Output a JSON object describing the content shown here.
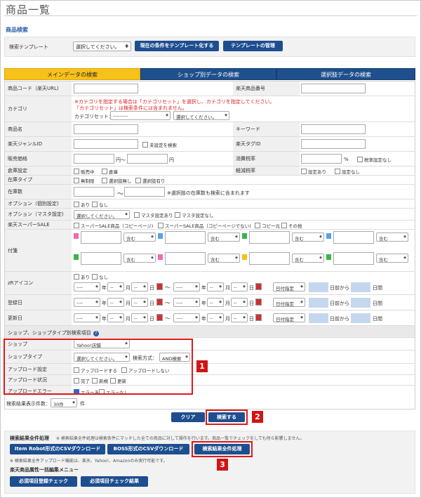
{
  "page": {
    "title": "商品一覧",
    "section": "商品検索"
  },
  "template": {
    "label": "検索テンプレート",
    "select_value": "選択してください。",
    "save_button": "現在の条件をテンプレート化する",
    "manage_button": "テンプレートの管理"
  },
  "tabs": [
    "メインデータの検索",
    "ショップ別データの検索",
    "選択肢データの検索"
  ],
  "labels": {
    "product_code": "商品コード（楽天URL)",
    "rakuten_no": "楽天商品番号",
    "category": "カテゴリ",
    "product_name": "商品名",
    "keyword": "キーワード",
    "genre_id": "楽天ジャンルID",
    "tag_id": "楽天タグID",
    "price": "販売価格",
    "tax": "消費税率",
    "warehouse": "倉庫設定",
    "reduced_tax": "軽減税率",
    "stock_type": "在庫タイプ",
    "stock_count": "在庫数",
    "option_individual": "オプション（個別設定)",
    "option_master": "オプション（マスタ設定)",
    "super_sale": "楽天スーパーSALE",
    "sticky": "付箋",
    "zr_icon": "zRアイコン",
    "reg_date": "登録日",
    "upd_date": "更新日",
    "shop_section": "ショップ、ショップタイプ別検索項目",
    "shop": "ショップ",
    "shop_type": "ショップタイプ",
    "upload_setting": "アップロード設定",
    "upload_status": "アップロード状況",
    "upload_error": "アップロードエラー"
  },
  "category": {
    "note1": "※カテゴリを指定する場合は「カテゴリセット」を選択し、カテゴリを指定してください。",
    "note2": "「カテゴリセット」は検索条件には含まれません。",
    "set_label": "カテゴリセット：",
    "set_value": "---------",
    "cat_value": "選択してください。"
  },
  "genre_unset": "未設定を検索",
  "price_yen1": "円～",
  "price_yen2": "円",
  "tax_pct": "%",
  "tax_unset": "税率設定なし",
  "warehouse_opts": [
    "販売中",
    "倉庫"
  ],
  "reduced_opts": [
    "設定あり",
    "設定なし"
  ],
  "stock_type_opts": [
    "無制限",
    "選択肢無し",
    "選択肢有り"
  ],
  "stock_tilde": "～",
  "stock_note": "※選択肢の在庫数も検索に含まれます",
  "ari_nashi": [
    "あり",
    "なし"
  ],
  "option_master_select": "選択してください。",
  "option_master_opts": [
    "マスタ設定あり",
    "マスタ設定なし"
  ],
  "super_sale_opts": [
    "スーパーSALE商品（コピーページ)",
    "スーパーSALE商品（コピーページでない)",
    "コピー元",
    "その他"
  ],
  "sticky_match": "含む",
  "date": {
    "dash4": "----",
    "dash2": "--",
    "year": "年",
    "month": "月",
    "day": "日",
    "tilde": "～",
    "spec": "日付指定",
    "from_days": "日前から",
    "days": "日間"
  },
  "shop": {
    "shop_value": "Yahoo!店舗",
    "type_value": "選択してください。",
    "method_label": "検索方式：",
    "method_value": "AND検索",
    "upload_setting_opts": [
      "アップロードする",
      "アップロードしない"
    ],
    "upload_status_opts": [
      "完了",
      "新規",
      "更新"
    ],
    "upload_error_opts": [
      "エラーあり",
      "エラーなし"
    ]
  },
  "results": {
    "label": "検索結果表示件数：",
    "value": "30件",
    "unit": "件"
  },
  "buttons": {
    "clear": "クリア",
    "search": "検索する"
  },
  "bulk": {
    "title": "検索結果全件処理",
    "note": "※ 検索結果全件処理は検索条件にマッチした全ての商品に対して操作を行います。商品一覧でチェックをしても何ら影響しません。",
    "btn_itemrobot": "Item Robot形式のCSVダウンロード",
    "btn_boss": "BOSS形式のCSVダウンロード",
    "btn_process": "検索結果全件処理",
    "note2": "※ 検索結果全件アップロード機能は、楽天、Yahoo!、Amazonのみ実行可能です。",
    "menu_title": "楽天商品属性一括編集メニュー",
    "btn_required": "必須項目登録チェック",
    "btn_result": "必須項目チェック結果"
  },
  "annotations": [
    "1",
    "2",
    "3"
  ],
  "colors": {
    "accent_yellow": "#f7c11b",
    "nav_blue": "#1f4f8c",
    "highlight_red": "#e01818"
  }
}
